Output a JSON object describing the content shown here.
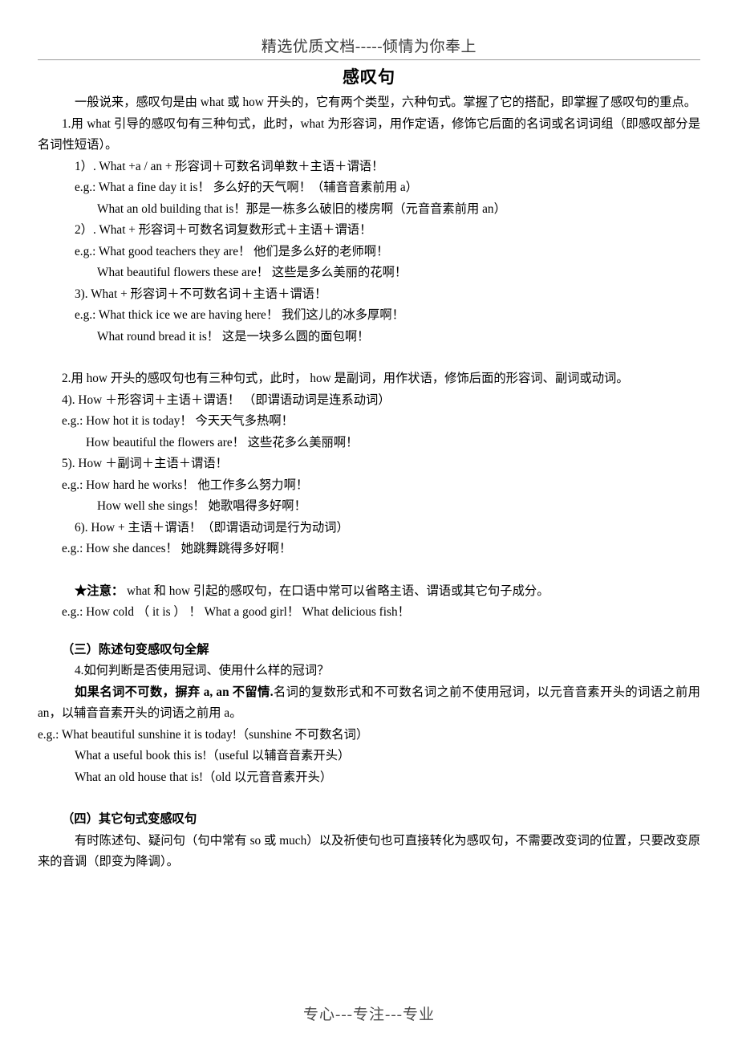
{
  "header": {
    "banner": "精选优质文档-----倾情为你奉上"
  },
  "footer": {
    "text": "专心---专注---专业"
  },
  "document": {
    "title": "感叹句",
    "intro": "一般说来，感叹句是由 what 或 how 开头的，它有两个类型，六种句式。掌握了它的搭配，即掌握了感叹句的重点。",
    "rule1": {
      "lead": "1.用 what 引导的感叹句有三种句式，此时，what 为形容词，用作定语，修饰它后面的名词或名词词组（即感叹部分是名词性短语）。",
      "patterns": [
        {
          "formula": "1）. What +a / an + 形容词＋可数名词单数＋主语＋谓语！",
          "examples": [
            "e.g.: What a fine day it is！  多么好的天气啊！（辅音音素前用 a）",
            "What an old building that is！那是一栋多么破旧的楼房啊（元音音素前用 an）"
          ]
        },
        {
          "formula": "2）. What + 形容词＋可数名词复数形式＋主语＋谓语！",
          "examples": [
            "e.g.: What good teachers they are！  他们是多么好的老师啊！",
            "What beautiful flowers these are！  这些是多么美丽的花啊！"
          ]
        },
        {
          "formula": "3). What + 形容词＋不可数名词＋主语＋谓语！",
          "examples": [
            "e.g.: What thick ice we are having here！  我们这儿的冰多厚啊！",
            "What round bread it is！  这是一块多么圆的面包啊！"
          ]
        }
      ]
    },
    "rule2": {
      "lead": "2.用 how 开头的感叹句也有三种句式，此时， how 是副词，用作状语，修饰后面的形容词、副词或动词。",
      "patterns": [
        {
          "formula": "4). How ＋形容词＋主语＋谓语！ （即谓语动词是连系动词）",
          "examples": [
            "e.g.: How hot it is today！  今天天气多热啊！",
            "How beautiful the flowers are！  这些花多么美丽啊！"
          ]
        },
        {
          "formula": "5). How ＋副词＋主语＋谓语！",
          "examples": [
            "e.g.: How hard he works！  他工作多么努力啊！",
            "How well she sings！  她歌唱得多好啊！"
          ]
        },
        {
          "formula": "6). How + 主语＋谓语！（即谓语动词是行为动词）",
          "examples": [
            "e.g.: How she dances！  她跳舞跳得多好啊！"
          ]
        }
      ]
    },
    "note": {
      "label": "★注意：",
      "text": " what 和 how 引起的感叹句，在口语中常可以省略主语、谓语或其它句子成分。",
      "example": "e.g.: How cold （ it is ） ！ What a good girl！ What delicious fish！"
    },
    "section3": {
      "heading": "（三）陈述句变感叹句全解",
      "question": "4.如何判断是否使用冠词、使用什么样的冠词？",
      "bold_rule": "如果名词不可数，摒弃 a, an 不留情.",
      "rule_rest": "名词的复数形式和不可数名词之前不使用冠词，以元音音素开头的词语之前用 an，以辅音音素开头的词语之前用 a。",
      "examples": [
        "e.g.: What beautiful sunshine it is today!（sunshine 不可数名词）",
        "What a useful book this is!（useful 以辅音音素开头）",
        "What an old house that is!（old 以元音音素开头）"
      ]
    },
    "section4": {
      "heading": "（四）其它句式变感叹句",
      "text": "有时陈述句、疑问句（句中常有 so 或 much）以及祈使句也可直接转化为感叹句，不需要改变词的位置，只要改变原来的音调（即变为降调）。"
    }
  }
}
